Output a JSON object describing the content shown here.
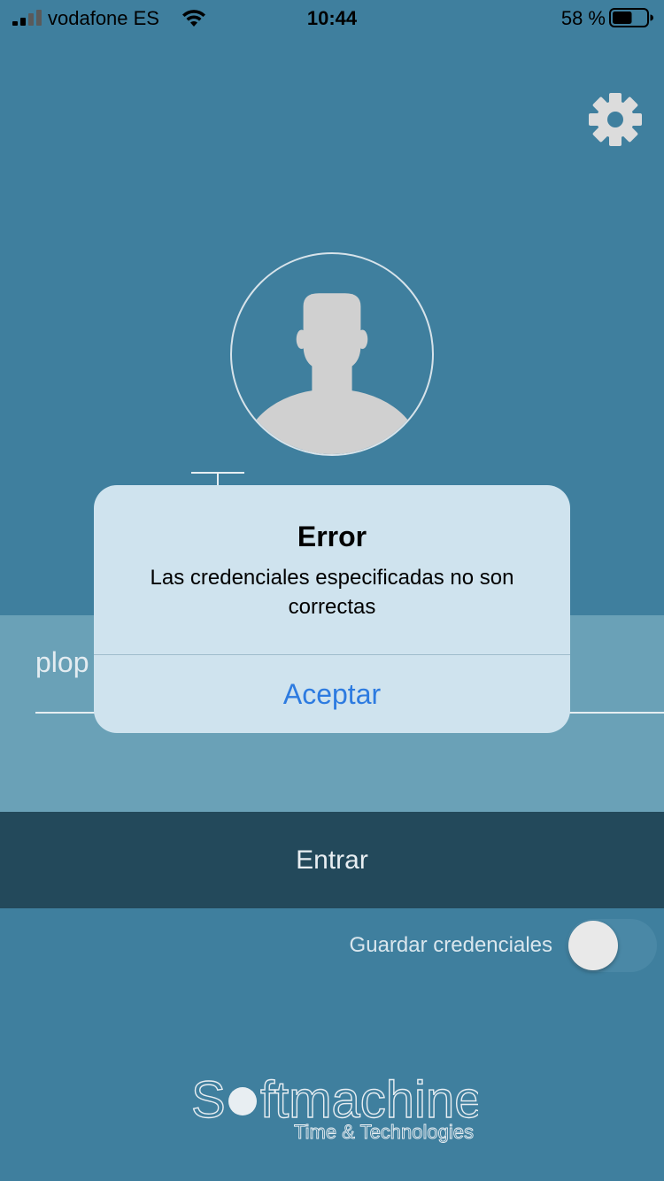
{
  "status_bar": {
    "carrier": "vodafone ES",
    "time": "10:44",
    "battery_percent": "58 %",
    "battery_level": 0.58
  },
  "login": {
    "username_value": "plop",
    "enter_label": "Entrar",
    "save_credentials_label": "Guardar credenciales",
    "save_credentials_on": false
  },
  "alert": {
    "title": "Error",
    "message": "Las credenciales especificadas no son correctas",
    "accept_label": "Aceptar"
  },
  "logo": {
    "name": "Softmachine",
    "tagline": "Time & Technologies"
  },
  "icons": {
    "settings": "gear-icon",
    "avatar": "user-silhouette",
    "signal": "cellular-signal-icon",
    "wifi": "wifi-icon",
    "battery": "battery-icon"
  },
  "colors": {
    "background": "#3f7f9e",
    "panel": "#6aa1b7",
    "button": "#23495b",
    "alert_button": "#2d7be0"
  }
}
